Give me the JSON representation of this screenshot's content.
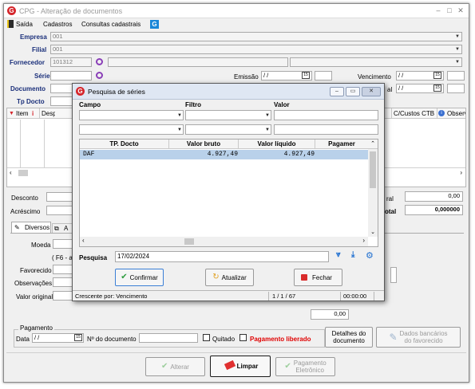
{
  "window": {
    "title": "CPG - Alteração de documentos"
  },
  "menu": {
    "saida": "Saída",
    "cadastros": "Cadastros",
    "consultas": "Consultas cadastrais",
    "help_icon": "G"
  },
  "form": {
    "empresa_label": "Empresa",
    "empresa_value": "001",
    "filial_label": "Filial",
    "filial_value": "001",
    "fornecedor_label": "Fornecedor",
    "fornecedor_value": "101312",
    "serie_label": "Série",
    "emissao_label": "Emissão",
    "emissao_value": "/ /",
    "vencimento_label": "Vencimento",
    "vencimento_value": "/ /",
    "documento_label": "Documento",
    "venc2_suffix": "al",
    "venc2_value": "/ /",
    "tpdocto_label": "Tp Docto"
  },
  "grid": {
    "col_item": "Item",
    "col_desp": "Desp",
    "col_ccustos": "C/Custos CTB",
    "col_obs": "Observ"
  },
  "totals": {
    "desconto_label": "Desconto",
    "acrescimo_label": "Acréscimo",
    "geral_suffix": "ral",
    "geral_value": "0,00",
    "total_suffix": "otal",
    "total_value": "0,000000"
  },
  "tabs": {
    "diversos": "Diversos",
    "a": "A"
  },
  "lower": {
    "moeda_label": "Moeda",
    "f6_hint": "( F6 - a",
    "favorecido_label": "Favorecido",
    "observacoes_label": "Observações",
    "valor_original_label": "Valor original",
    "right_value": "0,00"
  },
  "pagamento": {
    "group_label": "Pagamento",
    "data_label": "Data",
    "data_value": "/ /",
    "ndoc_label": "Nº do documento",
    "quitado_label": "Quitado",
    "liberado_label": "Pagamento liberado",
    "detalhes_btn": [
      "Detalhes do",
      "documento"
    ],
    "dados_btn": [
      "Dados bancários",
      "do favorecido"
    ]
  },
  "bottom_buttons": {
    "alterar": "Alterar",
    "limpar": "Limpar",
    "pagamento_eletronico": [
      "Pagamento",
      "Eletrônico"
    ]
  },
  "dialog": {
    "title": "Pesquisa de séries",
    "filter_headers": {
      "campo": "Campo",
      "filtro": "Filtro",
      "valor": "Valor"
    },
    "columns": [
      "TP. Docto",
      "Valor bruto",
      "Valor líquido",
      "Pagamer"
    ],
    "rows": [
      {
        "tp": "DAF",
        "bruto": "4.927,49",
        "liquido": "4.927,49",
        "pag": ""
      }
    ],
    "pesquisa_label": "Pesquisa",
    "pesquisa_value": "17/02/2024",
    "buttons": {
      "confirmar": "Confirmar",
      "atualizar": "Atualizar",
      "fechar": "Fechar"
    },
    "status": {
      "order": "Crescente por: Vencimento",
      "pages": "1 / 1 / 67",
      "time": "00:00:00"
    }
  },
  "colors": {
    "accent_red": "#d5262c",
    "label_blue": "#1a2f7a",
    "selected_row": "#b9d1ea",
    "liberado_red": "#e00000"
  }
}
